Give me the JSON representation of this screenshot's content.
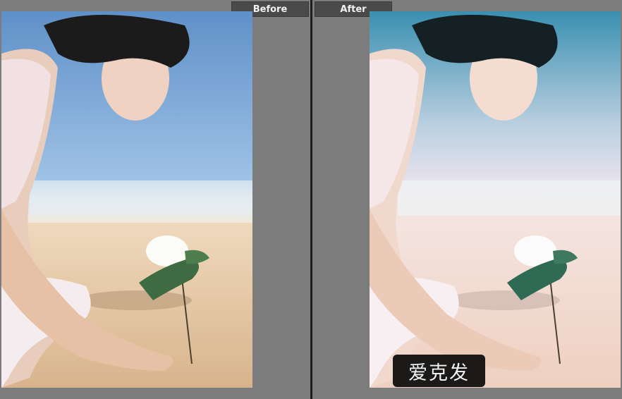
{
  "comparison": {
    "before": {
      "label": "Before"
    },
    "after": {
      "label": "After"
    },
    "watermark": "爱克发"
  },
  "colors": {
    "panel_background": "#7c7c7c",
    "divider": "#1e1e1e",
    "label_tab": "#4a4a4a",
    "watermark_background": "#1c1a19"
  },
  "icons": {
    "photo_before": "portrait-photo",
    "photo_after": "portrait-photo-edited"
  }
}
